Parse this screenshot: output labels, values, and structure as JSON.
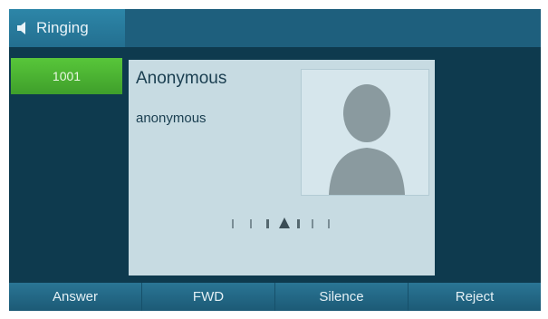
{
  "title_bar": {
    "status_text": "Ringing",
    "icon": "speaker-icon"
  },
  "line_key": {
    "label": "1001"
  },
  "call": {
    "caller_name": "Anonymous",
    "caller_number": "anonymous",
    "photo_icon": "avatar-silhouette-icon"
  },
  "progress": {
    "icon": "ringing-progress-icon"
  },
  "softkeys": [
    {
      "label": "Answer"
    },
    {
      "label": "FWD"
    },
    {
      "label": "Silence"
    },
    {
      "label": "Reject"
    }
  ]
}
